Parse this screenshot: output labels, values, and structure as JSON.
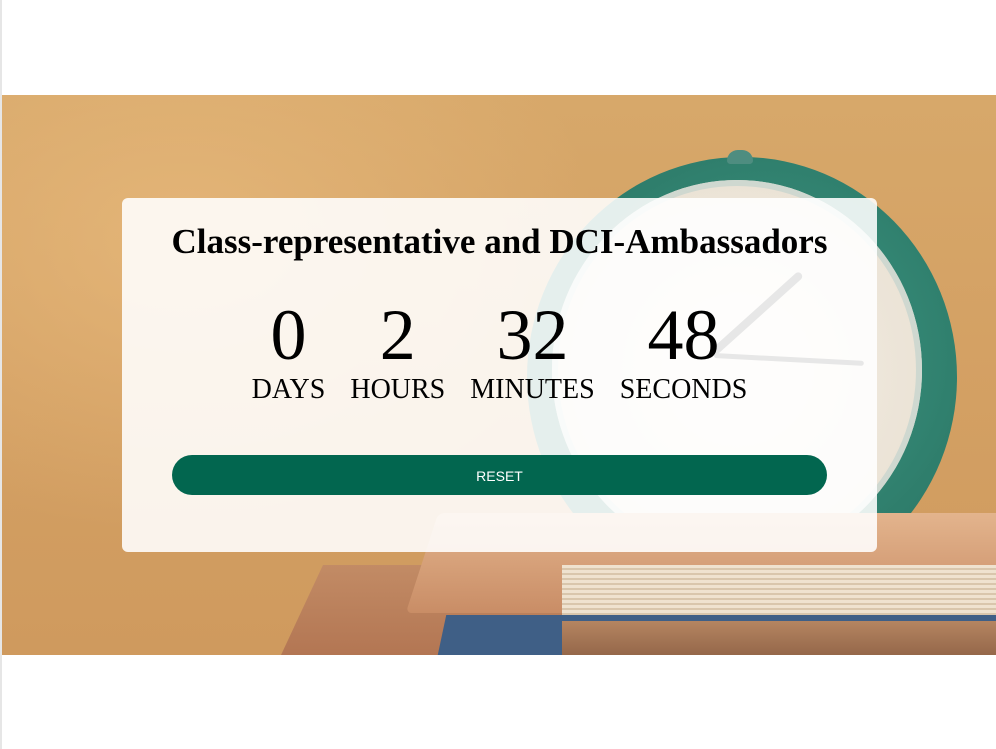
{
  "countdown": {
    "title": "Class-representative and DCI-Ambassadors",
    "units": [
      {
        "value": "0",
        "label": "DAYS"
      },
      {
        "value": "2",
        "label": "HOURS"
      },
      {
        "value": "32",
        "label": "MINUTES"
      },
      {
        "value": "48",
        "label": "SECONDS"
      }
    ],
    "reset_label": "RESET"
  },
  "colors": {
    "button": "#02664f",
    "card_background": "rgba(255,255,255,0.88)",
    "text": "#000000"
  },
  "background": {
    "image_subject": "teal-alarm-clock-on-books"
  }
}
